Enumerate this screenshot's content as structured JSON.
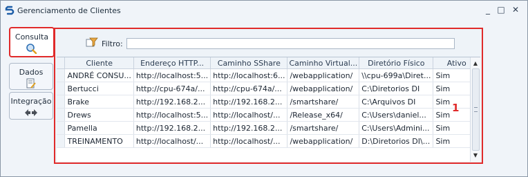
{
  "window": {
    "title": "Gerenciamento de Clientes",
    "minimize": "_",
    "maximize": "□",
    "close": "✕"
  },
  "tabs": [
    {
      "label": "Consulta",
      "icon": "magnifier-icon",
      "active": true
    },
    {
      "label": "Dados",
      "icon": "edit-document-icon",
      "active": false
    },
    {
      "label": "Integração",
      "icon": "integration-arrows-icon",
      "active": false
    }
  ],
  "filter": {
    "label": "Filtro:",
    "value": ""
  },
  "grid": {
    "columns": [
      "Cliente",
      "Endereço HTTP...",
      "Caminho SShare",
      "Caminho Virtual...",
      "Diretório Físico",
      "Ativo"
    ],
    "rows": [
      [
        "ANDRÉ CONSU...",
        "http://localhost:5...",
        "http://localhost:6...",
        "/webapplication/",
        "\\\\cpu-699a\\Diret...",
        "Sim"
      ],
      [
        "Bertucci",
        "http://cpu-674a/...",
        "http://cpu-674a/...",
        "/webapplication/",
        "C:\\Diretorios DI",
        "Sim"
      ],
      [
        "Brake",
        "http://192.168.2...",
        "http://192.168.2...",
        "/smartshare/",
        "C:\\Arquivos DI",
        "Sim"
      ],
      [
        "Drews",
        "http://localhost:5...",
        "http://localhost/...",
        "/Release_x64/",
        "C:\\Users\\daniel...",
        "Sim"
      ],
      [
        "Pamella",
        "http://192.168.2...",
        "http://192.168.2...",
        "/smartshare/",
        "C:\\Users\\Admini...",
        "Sim"
      ],
      [
        "TREINAMENTO",
        "http://localhost/...",
        "http://localhost/...",
        "/webapplication/",
        "D:\\Diretorios DI\\...",
        "Sim"
      ]
    ]
  },
  "annotation": "1",
  "colors": {
    "highlight": "#e02a2a",
    "background": "#f0f4f9"
  }
}
